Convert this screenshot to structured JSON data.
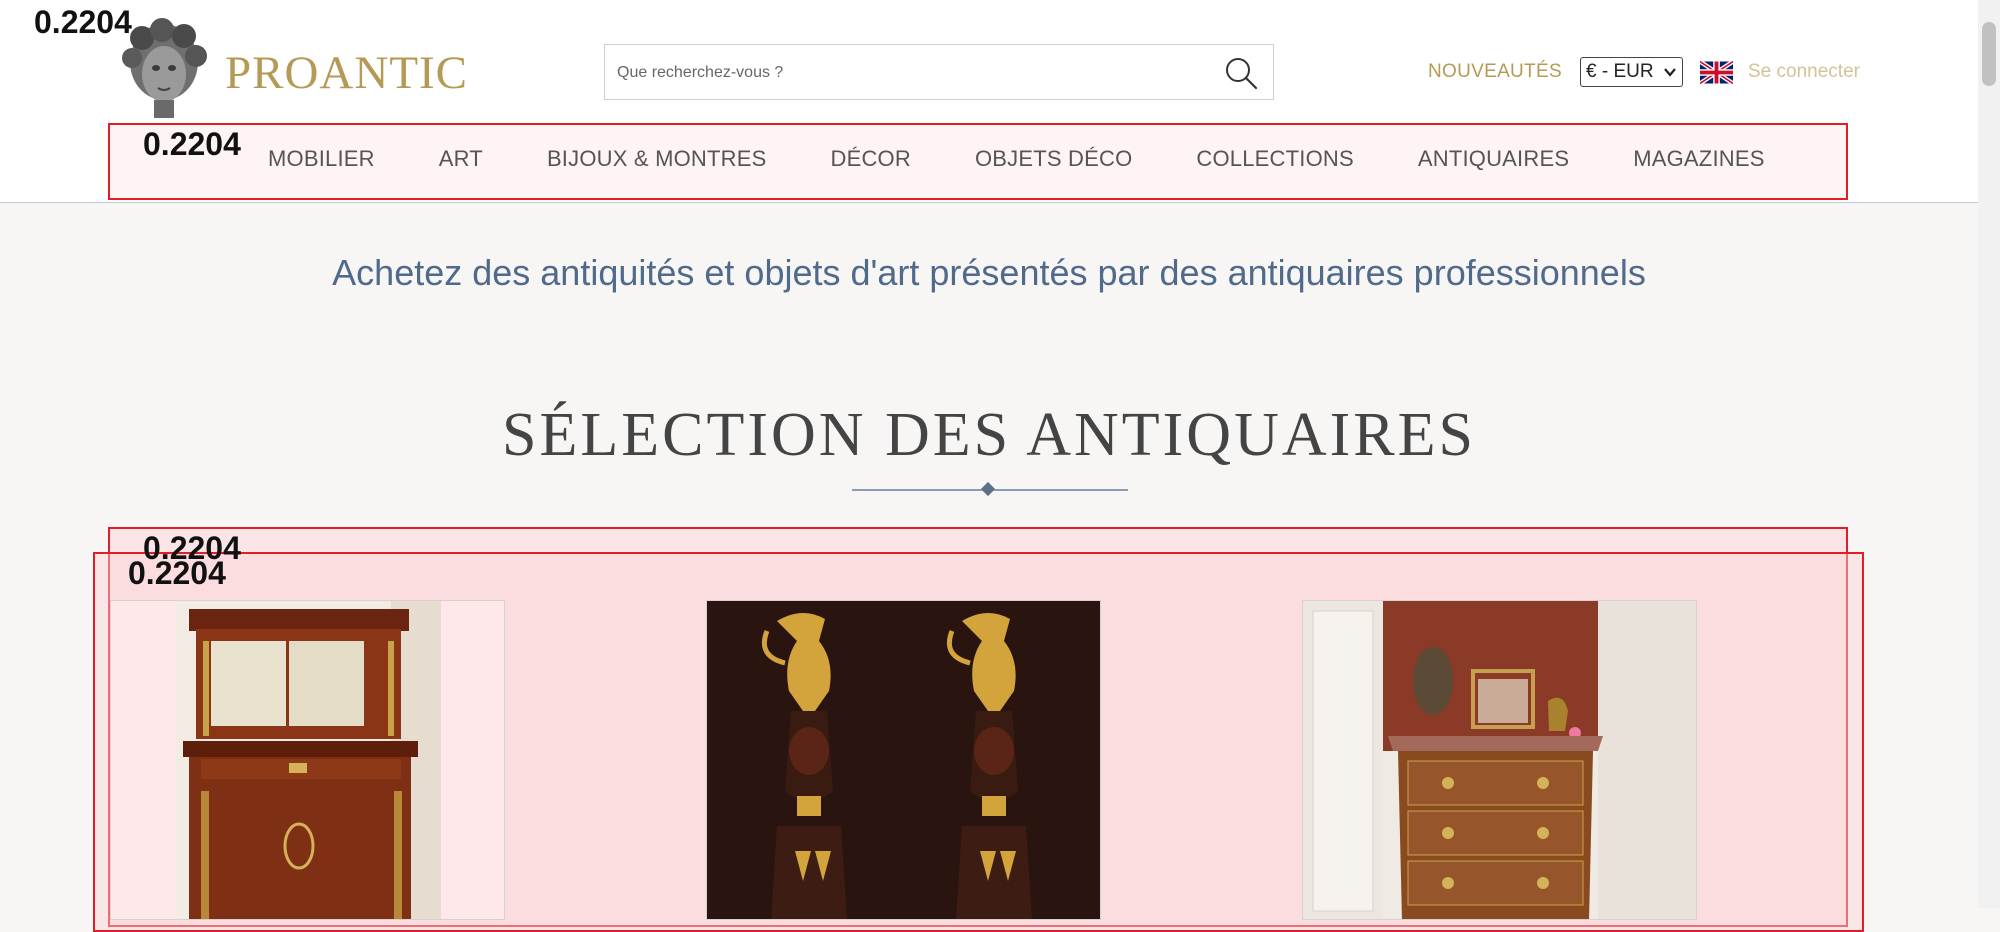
{
  "header": {
    "logo_text": "PROANTIC",
    "search_placeholder": "Que recherchez-vous ?",
    "nouveautes_label": "NOUVEAUTÉS",
    "currency_selected": "€ - EUR",
    "login_label": "Se connecter"
  },
  "nav": {
    "items": [
      {
        "label": "MOBILIER"
      },
      {
        "label": "ART"
      },
      {
        "label": "BIJOUX & MONTRES"
      },
      {
        "label": "DÉCOR"
      },
      {
        "label": "OBJETS DÉCO"
      },
      {
        "label": "COLLECTIONS"
      },
      {
        "label": "ANTIQUAIRES"
      },
      {
        "label": "MAGAZINES"
      }
    ]
  },
  "overlay_scores": {
    "logo": "0.2204",
    "nav": "0.2204",
    "selection_outer": "0.2204",
    "selection_inner": "0.2204"
  },
  "main": {
    "tagline": "Achetez des antiquités et objets d'art présentés par des antiquaires professionnels",
    "section_title": "SÉLECTION DES ANTIQUAIRES"
  },
  "colors": {
    "brand_gold": "#b59a56",
    "tagline_blue": "#4f6a8a",
    "highlight_red": "#e01e2a"
  },
  "icons": {
    "search": "search-icon",
    "flag": "uk-flag-icon",
    "dropdown": "chevron-down-icon"
  }
}
